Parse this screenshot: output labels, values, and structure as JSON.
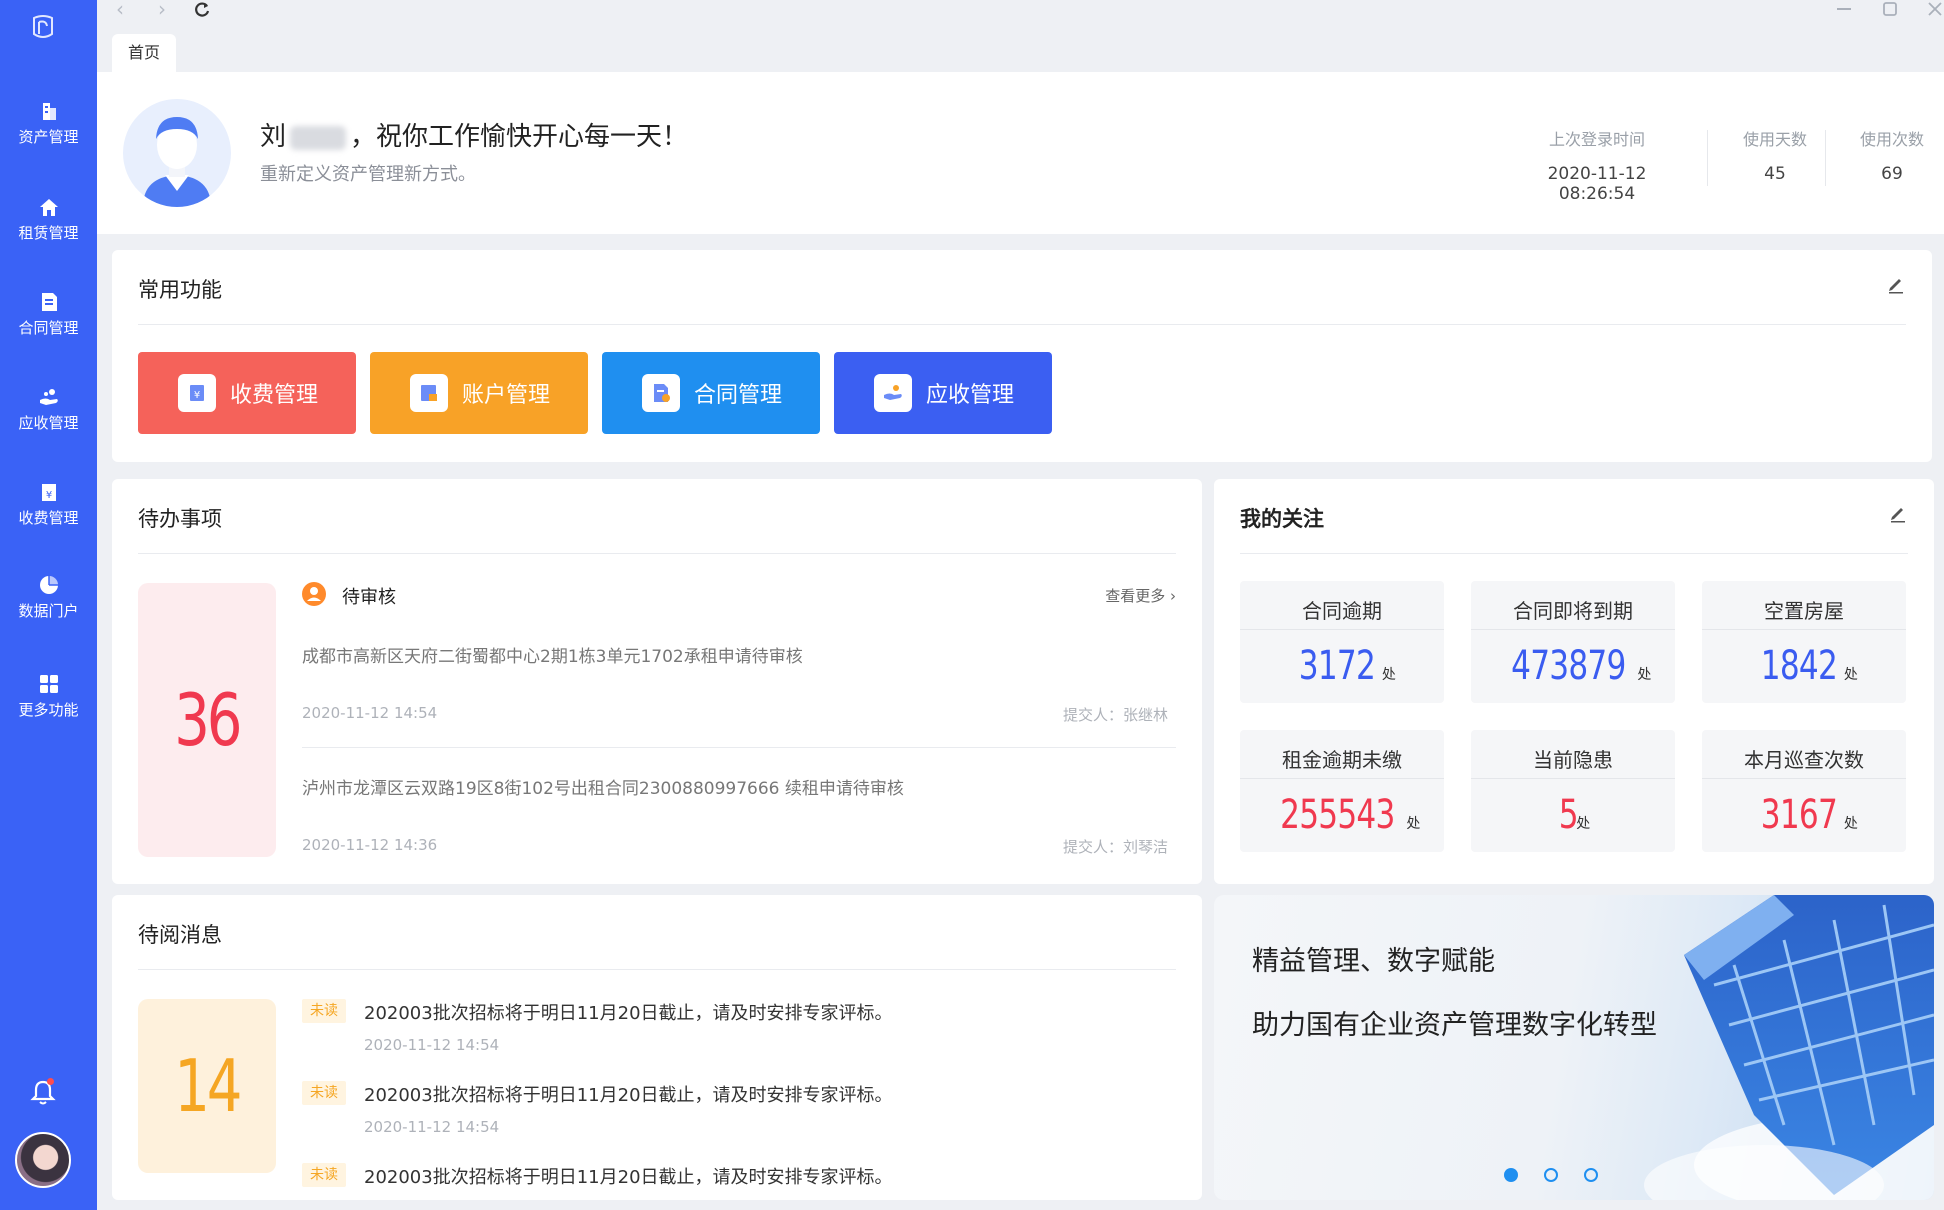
{
  "sidebar": {
    "items": [
      {
        "label": "资产管理",
        "icon": "building-icon"
      },
      {
        "label": "租赁管理",
        "icon": "home-icon"
      },
      {
        "label": "合同管理",
        "icon": "document-icon"
      },
      {
        "label": "应收管理",
        "icon": "hand-coins-icon"
      },
      {
        "label": "收费管理",
        "icon": "money-box-icon"
      },
      {
        "label": "数据门户",
        "icon": "pie-chart-icon"
      },
      {
        "label": "更多功能",
        "icon": "grid-icon"
      }
    ]
  },
  "tabs": [
    {
      "label": "首页"
    }
  ],
  "header": {
    "greeting_prefix": "刘",
    "greeting_suffix": "，祝你工作愉快开心每一天！",
    "subtitle": "重新定义资产管理新方式。",
    "stats": [
      {
        "label": "上次登录时间",
        "value": "2020-11-12 08:26:54"
      },
      {
        "label": "使用天数",
        "value": "45"
      },
      {
        "label": "使用次数",
        "value": "69"
      }
    ]
  },
  "quick": {
    "title": "常用功能",
    "buttons": [
      {
        "label": "收费管理",
        "color": "#f5625a"
      },
      {
        "label": "账户管理",
        "color": "#f8a227"
      },
      {
        "label": "合同管理",
        "color": "#1f8ff0"
      },
      {
        "label": "应收管理",
        "color": "#3b5ff2"
      }
    ]
  },
  "todo": {
    "title": "待办事项",
    "count": "36",
    "section_title": "待审核",
    "more": "查看更多",
    "items": [
      {
        "text": "成都市高新区天府二街蜀都中心2期1栋3单元1702承租申请待审核",
        "time": "2020-11-12   14:54",
        "submitter": "提交人：张继林"
      },
      {
        "text": "泸州市龙潭区云双路19区8街102号出租合同2300880997666 续租申请待审核",
        "time": "2020-11-12   14:36",
        "submitter": "提交人：刘琴洁"
      }
    ]
  },
  "attention": {
    "title": "我的关注",
    "unit": "处",
    "items": [
      {
        "label": "合同逾期",
        "value": "3172",
        "color": "#3a5cf0"
      },
      {
        "label": "合同即将到期",
        "value": "473879",
        "color": "#3a5cf0"
      },
      {
        "label": "空置房屋",
        "value": "1842",
        "color": "#3a5cf0"
      },
      {
        "label": "租金逾期未缴",
        "value": "255543",
        "color": "#f0394f"
      },
      {
        "label": "当前隐患",
        "value": "5",
        "color": "#f0394f"
      },
      {
        "label": "本月巡查次数",
        "value": "3167",
        "color": "#f0394f"
      }
    ]
  },
  "messages": {
    "title": "待阅消息",
    "count": "14",
    "tag": "未读",
    "items": [
      {
        "text": "202003批次招标将于明日11月20日截止，请及时安排专家评标。",
        "time": "2020-11-12   14:54"
      },
      {
        "text": "202003批次招标将于明日11月20日截止，请及时安排专家评标。",
        "time": "2020-11-12   14:54"
      },
      {
        "text": "202003批次招标将于明日11月20日截止，请及时安排专家评标。",
        "time": ""
      }
    ]
  },
  "banner": {
    "line1": "精益管理、数字赋能",
    "line2": "助力国有企业资产管理数字化转型",
    "dots": 3,
    "active_dot": 0
  }
}
